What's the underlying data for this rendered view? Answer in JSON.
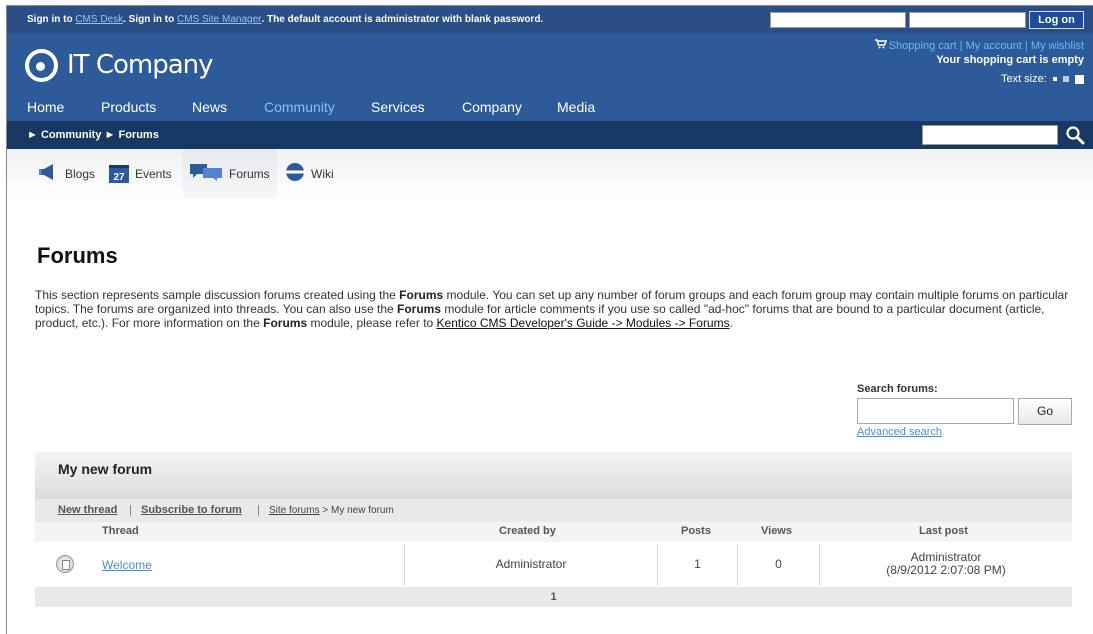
{
  "topbar": {
    "signin_prefix": "Sign in to ",
    "cms_desk": "CMS Desk",
    "signin_mid": ". Sign in to ",
    "site_manager": "CMS Site Manager",
    "signin_suffix": ". The default account is administrator with blank password.",
    "logon_label": "Log on"
  },
  "header": {
    "logo_text": "IT Company",
    "shopping_cart": "Shopping cart",
    "my_account": "My account",
    "my_wishlist": "My wishlist",
    "sep": " | ",
    "cart_status": "Your shopping cart is empty",
    "text_size_label": "Text size:"
  },
  "nav": {
    "items": [
      {
        "label": "Home"
      },
      {
        "label": "Products"
      },
      {
        "label": "News"
      },
      {
        "label": "Community"
      },
      {
        "label": "Services"
      },
      {
        "label": "Company"
      },
      {
        "label": "Media"
      }
    ],
    "active": "Community"
  },
  "breadcrumb": {
    "arrow": "►",
    "level1": "Community",
    "level2": "Forums"
  },
  "subtabs": [
    {
      "label": "Blogs",
      "icon": "megaphone-icon"
    },
    {
      "label": "Events",
      "icon": "calendar-icon",
      "icon_text": "27"
    },
    {
      "label": "Forums",
      "icon": "speech-bubbles-icon"
    },
    {
      "label": "Wiki",
      "icon": "globe-icon"
    }
  ],
  "page": {
    "title": "Forums",
    "intro_1": "This section represents sample discussion forums created using the ",
    "intro_bold_1": "Forums",
    "intro_2": " module. You can set up any number of forum groups and each forum group may contain multiple forums on particular topics. The forums are organized into threads. You can also use the ",
    "intro_bold_2": "Forums",
    "intro_3": " module for article comments if you use so called \"ad-hoc\" forums that are bound to a particular document (article, product, etc.). For more information on the ",
    "intro_bold_3": "Forums",
    "intro_4": " module, please refer to ",
    "intro_link": "Kentico CMS Developer's Guide -> Modules -> Forums",
    "intro_end": "."
  },
  "search_forums": {
    "label": "Search forums:",
    "value": "",
    "go_label": "Go",
    "advanced": "Advanced search"
  },
  "forum": {
    "title": "My new forum",
    "new_thread": "New thread",
    "subscribe": "Subscribe to forum",
    "sep": "|",
    "site_forums": "Site forums",
    "crumb_sep": " > ",
    "crumb_current": "My new forum",
    "columns": {
      "thread": "Thread",
      "created_by": "Created by",
      "posts": "Posts",
      "views": "Views",
      "last_post": "Last post"
    },
    "rows": [
      {
        "thread": "Welcome",
        "created_by": "Administrator",
        "posts": "1",
        "views": "0",
        "last_post_by": "Administrator",
        "last_post_date": "(8/9/2012 2:07:08 PM)"
      }
    ],
    "pager": "1"
  }
}
